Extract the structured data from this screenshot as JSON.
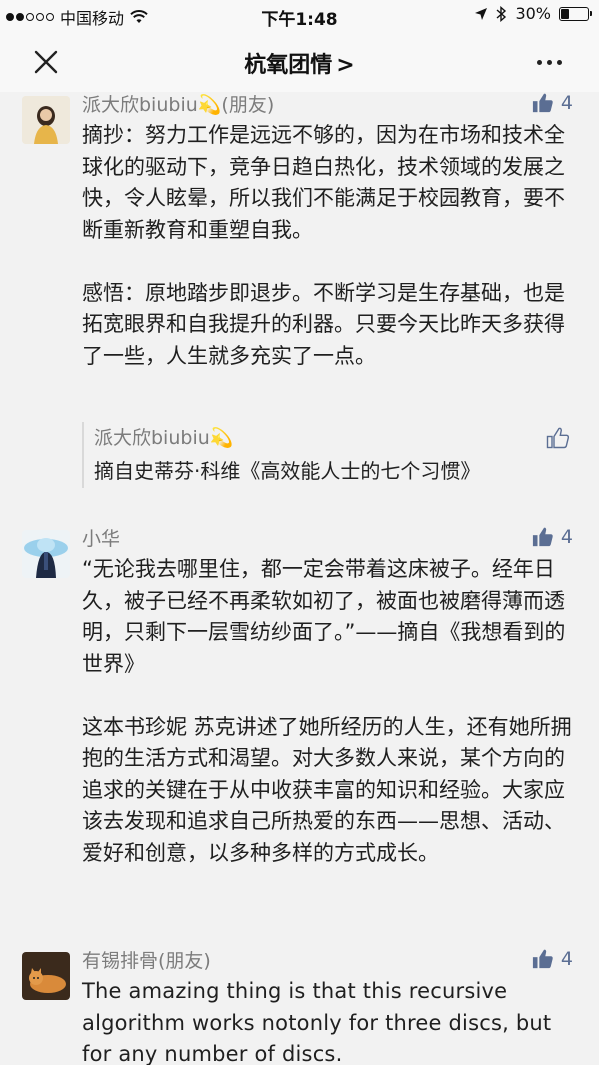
{
  "status_bar": {
    "carrier": "中国移动",
    "time": "下午1:48",
    "battery_percent": "30%",
    "battery_level": 0.3,
    "signal_icon": "signal-dots-icon",
    "wifi_icon": "wifi-icon"
  },
  "nav": {
    "title": "杭氧团情",
    "title_chevron": ">",
    "close_icon": "close-icon",
    "more_icon": "more-dots-icon"
  },
  "comments": [
    {
      "name": "派大欣biubiu💫(朋友)",
      "likes": "4",
      "paragraphs": [
        "摘抄：努力工作是远远不够的，因为在市场和技术全球化的驱动下，竞争日趋白热化，技术领域的发展之快，令人眩晕，所以我们不能满足于校园教育，要不断重新教育和重塑自我。",
        "感悟：原地踏步即退步。不断学习是生存基础，也是拓宽眼界和自我提升的利器。只要今天比昨天多获得了一些，人生就多充实了一点。"
      ],
      "reply": {
        "name": "派大欣biubiu💫",
        "text": "摘自史蒂芬·科维《高效能人士的七个习惯》"
      }
    },
    {
      "name": "小华",
      "likes": "4",
      "paragraphs": [
        "“无论我去哪里住，都一定会带着这床被子。经年日久，被子已经不再柔软如初了，被面也被磨得薄而透明，只剩下一层雪纺纱面了。”——摘自《我想看到的世界》",
        "这本书珍妮 苏克讲述了她所经历的人生，还有她所拥抱的生活方式和渴望。对大多数人来说，某个方向的追求的关键在于从中收获丰富的知识和经验。大家应该去发现和追求自己所热爱的东西——思想、活动、爱好和创意，以多种多样的方式成长。"
      ]
    },
    {
      "name": "有锡排骨(朋友)",
      "likes": "4",
      "paragraphs": [
        "The amazing thing is that this recursive algorithm works notonly for three discs, but for any number of discs."
      ]
    }
  ],
  "colors": {
    "background": "#f2f2f2",
    "name_gray": "#7c7c7c",
    "like_blue": "#5b6e93"
  }
}
